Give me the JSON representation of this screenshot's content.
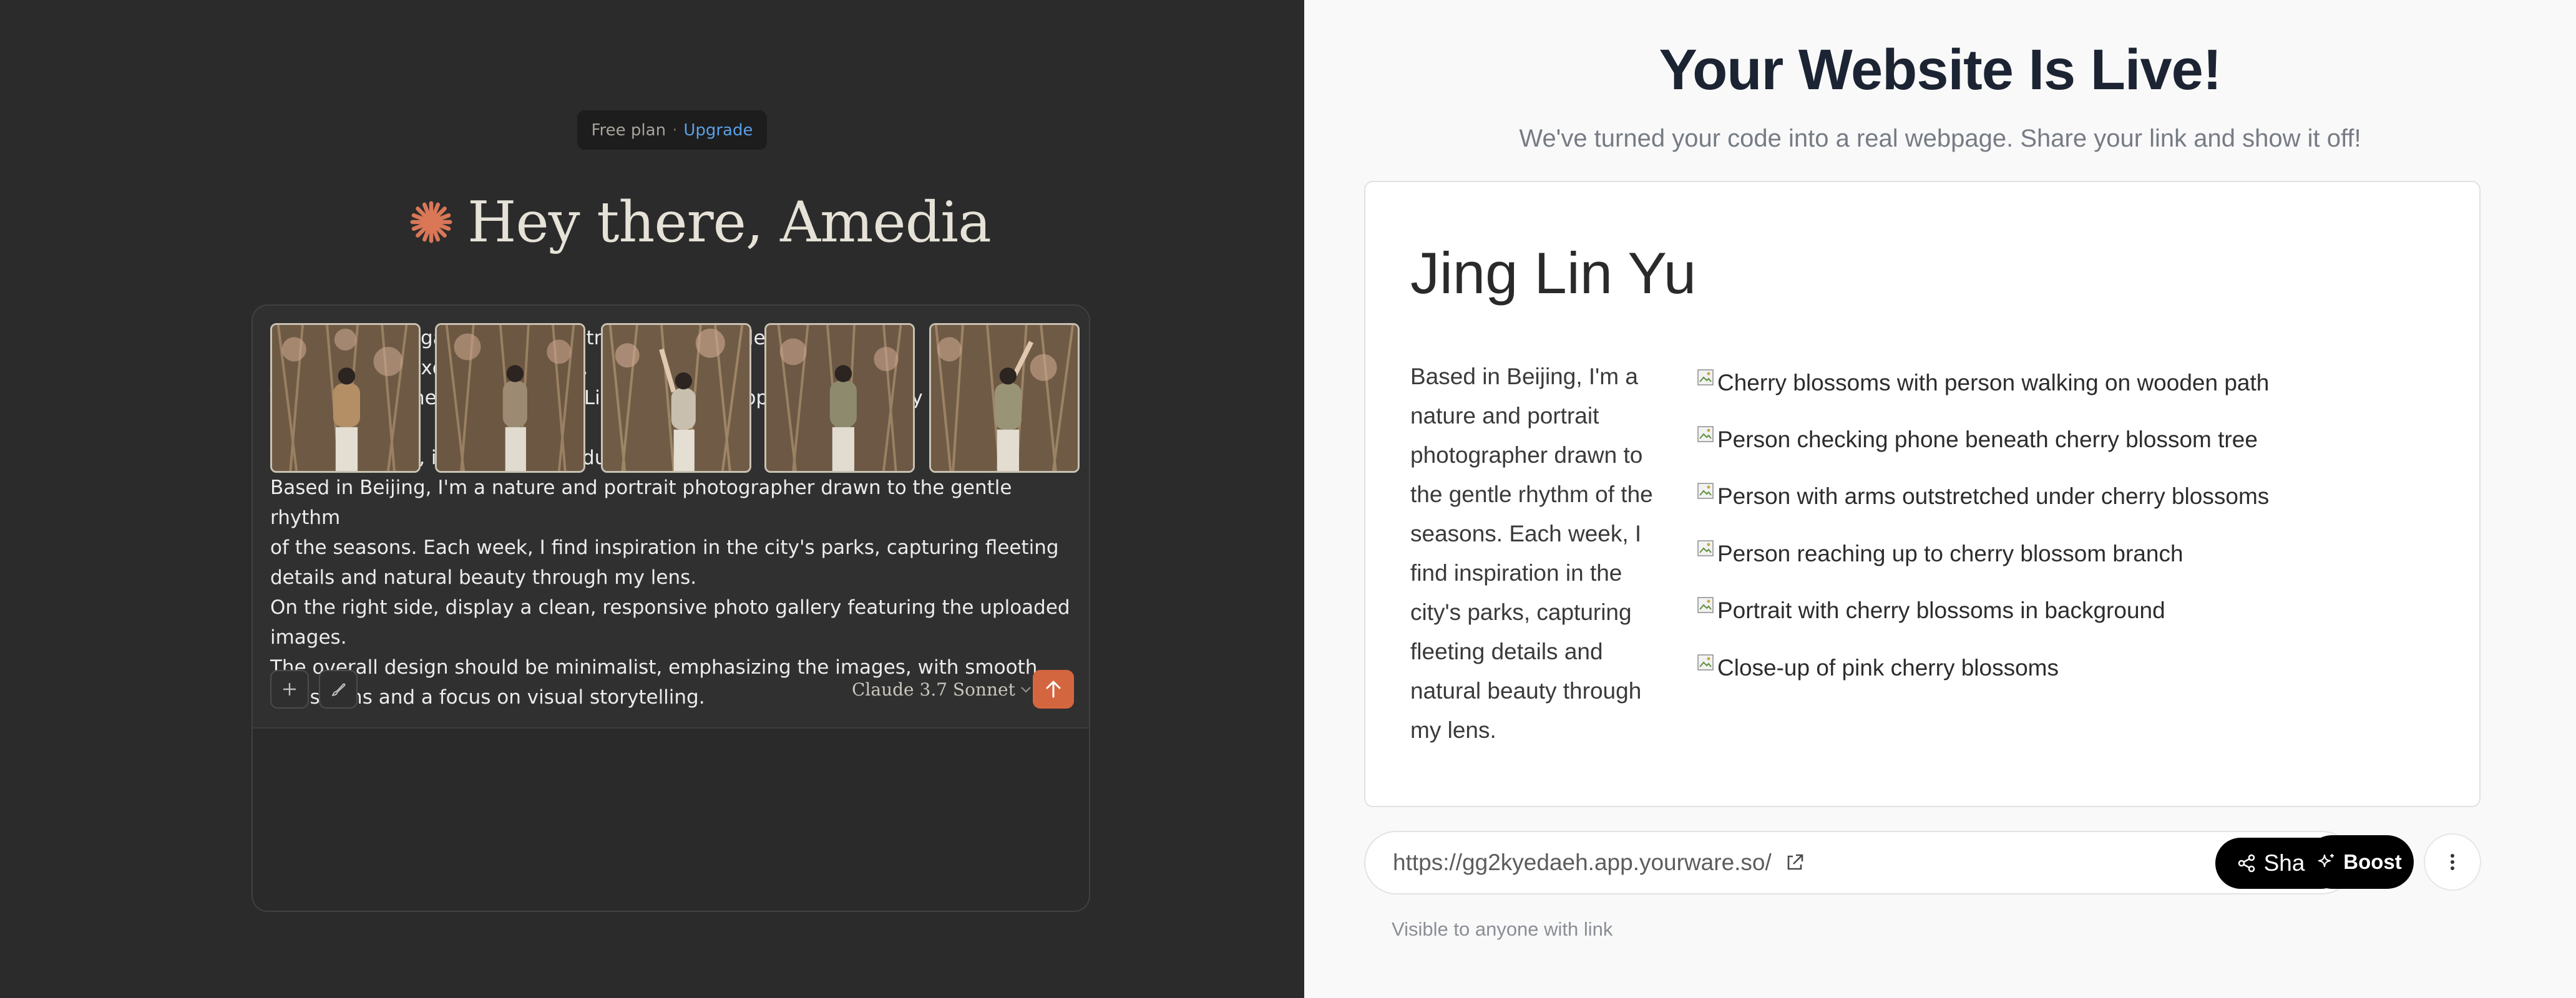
{
  "plan": {
    "label": "Free plan",
    "separator": "·",
    "upgrade": "Upgrade"
  },
  "greeting": "Hey there, Amedia",
  "composer": {
    "prompt_text": "Create a photo gallery website html similar in style and layout to\nhttps://www.felixdolmaillot.com/.\nThe photographer's name, \"Jing Lin Yu\", should appear prominently as the headline.\nOn the left side, include an introduction text:\nBased in Beijing, I'm a nature and portrait photographer drawn to the gentle rhythm\nof the seasons. Each week, I find inspiration in the city's parks, capturing fleeting\ndetails and natural beauty through my lens.\nOn the right side, display a clean, responsive photo gallery featuring the uploaded\nimages.\nThe overall design should be minimalist, emphasizing the images, with smooth\ntransitions and a focus on visual storytelling.",
    "model": "Claude 3.7 Sonnet",
    "attachment_count": 5
  },
  "result": {
    "title": "Your Website Is Live!",
    "subtitle": "We've turned your code into a real webpage. Share your link and show it off!",
    "site": {
      "headline": "Jing Lin Yu",
      "intro": "Based in Beijing, I'm a nature and portrait photographer drawn to the gentle rhythm of the seasons. Each week, I find inspiration in the city's parks, capturing fleeting details and natural beauty through my lens.",
      "gallery": [
        "Cherry blossoms with person walking on wooden path",
        "Person checking phone beneath cherry blossom tree",
        "Person with arms outstretched under cherry blossoms",
        "Person reaching up to cherry blossom branch",
        "Portrait with cherry blossoms in background",
        "Close-up of pink cherry blossoms"
      ]
    },
    "url": "https://gg2kyedaeh.app.yourware.so/",
    "share_label": "Share",
    "boost_label": "Boost",
    "visibility": "Visible to anyone with link"
  },
  "icons": {
    "greeting_star": "asterisk-star-icon",
    "add": "plus-icon",
    "brush": "brush-icon",
    "model_chevron": "chevron-down-icon",
    "send": "arrow-up-icon",
    "external_link": "external-link-icon",
    "share": "share-icon",
    "boost": "sparkle-icon",
    "more": "vertical-dots-icon",
    "broken_image": "broken-image-icon"
  },
  "colors": {
    "accent_orange": "#d4663f",
    "link_blue": "#5a9fe6",
    "dark_bg": "#2b2b2b",
    "light_bg": "#f9f9f9"
  }
}
